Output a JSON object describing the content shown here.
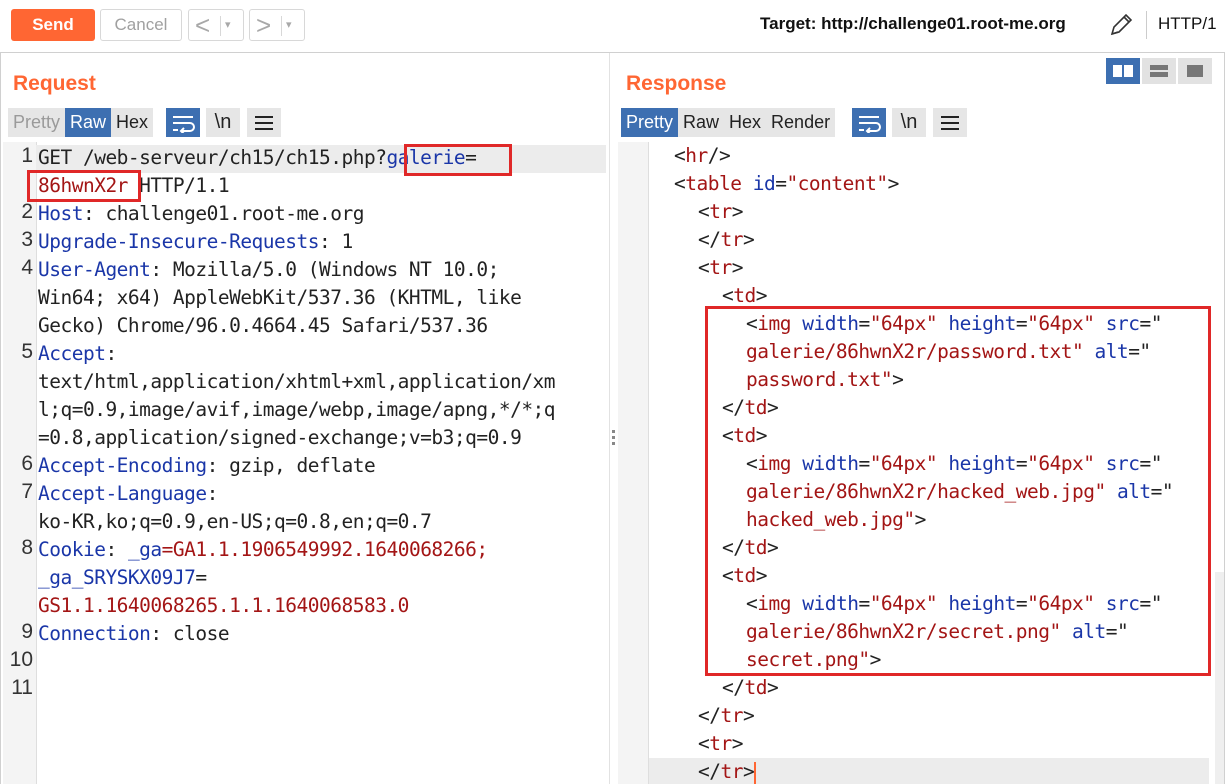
{
  "toolbar": {
    "send_label": "Send",
    "cancel_label": "Cancel",
    "back_arrow": "<",
    "forward_arrow": ">",
    "dropdown_glyph": "▾",
    "target_text": "Target: http://challenge01.root-me.org",
    "protocol": "HTTP/1"
  },
  "request": {
    "title": "Request",
    "tabs": [
      "Pretty",
      "Raw",
      "Hex"
    ],
    "active_tab": "Raw",
    "newline_label": "\\n",
    "lines": [
      {
        "n": "1"
      },
      {
        "n": "2"
      },
      {
        "n": "3"
      },
      {
        "n": "4"
      },
      {
        "n": "5"
      },
      {
        "n": "6"
      },
      {
        "n": "7"
      },
      {
        "n": "8"
      },
      {
        "n": "9"
      },
      {
        "n": "10"
      },
      {
        "n": "11"
      }
    ],
    "l1_method": "GET /web-serveur/ch15/ch15.php?",
    "l1_param": "galerie",
    "l1_eq": "=",
    "l1_value": "86hwnX2r",
    "l1_proto": " HTTP/1.1",
    "l2_key": "Host",
    "l2_val": ": challenge01.root-me.org",
    "l3_key": "Upgrade-Insecure-Requests",
    "l3_val": ": 1",
    "l4_key": "User-Agent",
    "l4_val1": ": Mozilla/5.0 (Windows NT 10.0;",
    "l4_val2": "Win64; x64) AppleWebKit/537.36 (KHTML, like",
    "l4_val3": "Gecko) Chrome/96.0.4664.45 Safari/537.36",
    "l5_key": "Accept",
    "l5_colon": ":",
    "l5_val1": "text/html,application/xhtml+xml,application/xm",
    "l5_val2": "l;q=0.9,image/avif,image/webp,image/apng,*/*;q",
    "l5_val3": "=0.8,application/signed-exchange;v=b3;q=0.9",
    "l6_key": "Accept-Encoding",
    "l6_val": ": gzip, deflate",
    "l7_key": "Accept-Language",
    "l7_colon": ":",
    "l7_val": "ko-KR,ko;q=0.9,en-US;q=0.8,en;q=0.7",
    "l8_key": "Cookie",
    "l8_sep": ": ",
    "l8_c1": "_ga",
    "l8_v1": "=GA1.1.1906549992.1640068266;",
    "l8_c2": "_ga_SRYSKX09J7",
    "l8_eq": "=",
    "l8_v2": "GS1.1.1640068265.1.1.1640068583.0",
    "l9_key": "Connection",
    "l9_val": ": close"
  },
  "response": {
    "title": "Response",
    "tabs": [
      "Pretty",
      "Raw",
      "Hex",
      "Render"
    ],
    "active_tab": "Pretty",
    "newline_label": "\\n",
    "r_hr_tag": "hr",
    "r_table_tag": "table",
    "r_id_attr": "id",
    "r_id_val": "\"content\"",
    "r_tr": "tr",
    "r_td": "td",
    "r_img": "img",
    "r_width_attr": "width",
    "r_width_val": "\"64px\"",
    "r_height_attr": "height",
    "r_height_val": "\"64px\"",
    "r_src_attr": "src",
    "r_alt_attr": "alt",
    "img1_src": "galerie/86hwnX2r/password.txt\"",
    "img1_alt": "password.txt\"",
    "img2_src": "galerie/86hwnX2r/hacked_web.jpg\"",
    "img2_alt": "hacked_web.jpg\"",
    "img3_src": "galerie/86hwnX2r/secret.png\"",
    "img3_alt": "secret.png\""
  },
  "colors": {
    "accent": "#ff6633",
    "active_tab": "#3d6fb1",
    "highlight_box": "#e02828"
  }
}
